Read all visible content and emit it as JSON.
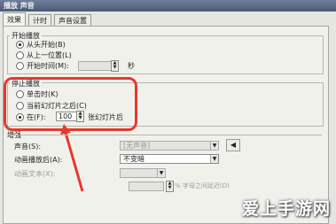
{
  "window": {
    "title": "播放 声音"
  },
  "tabs": [
    {
      "label": "效果"
    },
    {
      "label": "计时"
    },
    {
      "label": "声音设置"
    }
  ],
  "start_group": {
    "title": "开始播放",
    "options": [
      {
        "label": "从头开始(B)",
        "selected": true
      },
      {
        "label": "从上一位置(L)",
        "selected": false
      },
      {
        "label": "开始时间(M):",
        "selected": false
      }
    ],
    "time_unit": "秒"
  },
  "stop_group": {
    "title": "停止播放",
    "options": [
      {
        "label": "单击时(K)",
        "selected": false
      },
      {
        "label": "当前幻灯片之后(C)",
        "selected": false
      },
      {
        "label": "在(F):",
        "selected": true
      }
    ],
    "after_count": "100",
    "after_suffix": "张幻灯片后"
  },
  "enhance_group": {
    "title": "增强",
    "sound_label": "声音(S):",
    "sound_value": "[无声音]",
    "after_anim_label": "动画播放后(A):",
    "after_anim_value": "不变暗",
    "anim_text_label": "动画文本(X):",
    "anim_text_suffix": "% 字母之间延迟(D)"
  },
  "watermark": "爱上手游网",
  "colors": {
    "highlight": "#e53a2e"
  }
}
